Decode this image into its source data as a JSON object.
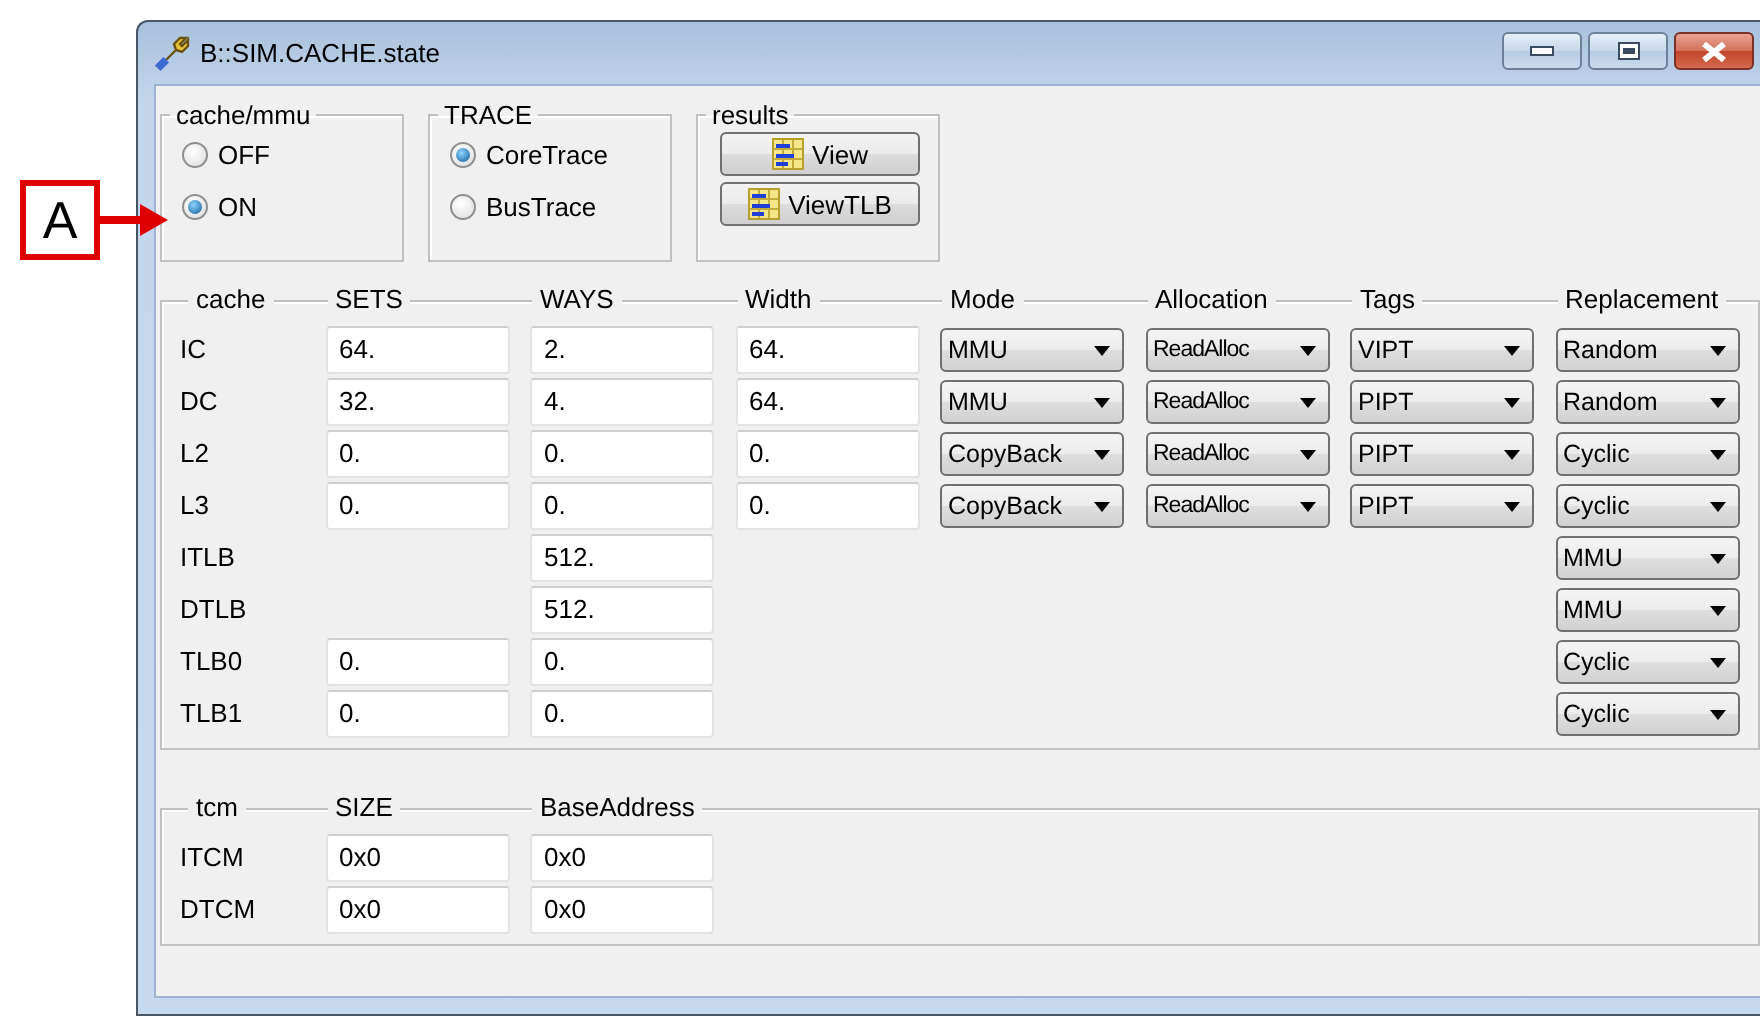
{
  "window": {
    "title": "B::SIM.CACHE.state"
  },
  "callout": {
    "label": "A"
  },
  "groups": [
    {
      "title": "cache/mmu",
      "kind": "radio",
      "options": [
        {
          "label": "OFF",
          "selected": false
        },
        {
          "label": "ON",
          "selected": true
        }
      ]
    },
    {
      "title": "TRACE",
      "kind": "radio",
      "options": [
        {
          "label": "CoreTrace",
          "selected": true
        },
        {
          "label": "BusTrace",
          "selected": false
        }
      ]
    },
    {
      "title": "results",
      "kind": "buttons",
      "buttons": [
        "View",
        "ViewTLB"
      ]
    }
  ],
  "cache": {
    "columns": [
      "cache",
      "SETS",
      "WAYS",
      "Width",
      "Mode",
      "Allocation",
      "Tags",
      "Replacement"
    ],
    "rows": [
      {
        "cells": [
          {
            "kind": "label",
            "value": "IC"
          },
          {
            "kind": "field",
            "value": "64."
          },
          {
            "kind": "field",
            "value": "2."
          },
          {
            "kind": "field",
            "value": "64."
          },
          {
            "kind": "dropdown",
            "value": "MMU"
          },
          {
            "kind": "dropdown",
            "value": "ReadAlloc"
          },
          {
            "kind": "dropdown",
            "value": "VIPT"
          },
          {
            "kind": "dropdown",
            "value": "Random"
          }
        ]
      },
      {
        "cells": [
          {
            "kind": "label",
            "value": "DC"
          },
          {
            "kind": "field",
            "value": "32."
          },
          {
            "kind": "field",
            "value": "4."
          },
          {
            "kind": "field",
            "value": "64."
          },
          {
            "kind": "dropdown",
            "value": "MMU"
          },
          {
            "kind": "dropdown",
            "value": "ReadAlloc"
          },
          {
            "kind": "dropdown",
            "value": "PIPT"
          },
          {
            "kind": "dropdown",
            "value": "Random"
          }
        ]
      },
      {
        "cells": [
          {
            "kind": "label",
            "value": "L2"
          },
          {
            "kind": "field",
            "value": "0."
          },
          {
            "kind": "field",
            "value": "0."
          },
          {
            "kind": "field",
            "value": "0."
          },
          {
            "kind": "dropdown",
            "value": "CopyBack"
          },
          {
            "kind": "dropdown",
            "value": "ReadAlloc"
          },
          {
            "kind": "dropdown",
            "value": "PIPT"
          },
          {
            "kind": "dropdown",
            "value": "Cyclic"
          }
        ]
      },
      {
        "cells": [
          {
            "kind": "label",
            "value": "L3"
          },
          {
            "kind": "field",
            "value": "0."
          },
          {
            "kind": "field",
            "value": "0."
          },
          {
            "kind": "field",
            "value": "0."
          },
          {
            "kind": "dropdown",
            "value": "CopyBack"
          },
          {
            "kind": "dropdown",
            "value": "ReadAlloc"
          },
          {
            "kind": "dropdown",
            "value": "PIPT"
          },
          {
            "kind": "dropdown",
            "value": "Cyclic"
          }
        ]
      },
      {
        "cells": [
          {
            "kind": "label",
            "value": "ITLB"
          },
          {
            "kind": "empty"
          },
          {
            "kind": "field",
            "value": "512."
          },
          {
            "kind": "empty"
          },
          {
            "kind": "empty"
          },
          {
            "kind": "empty"
          },
          {
            "kind": "empty"
          },
          {
            "kind": "dropdown",
            "value": "MMU"
          }
        ]
      },
      {
        "cells": [
          {
            "kind": "label",
            "value": "DTLB"
          },
          {
            "kind": "empty"
          },
          {
            "kind": "field",
            "value": "512."
          },
          {
            "kind": "empty"
          },
          {
            "kind": "empty"
          },
          {
            "kind": "empty"
          },
          {
            "kind": "empty"
          },
          {
            "kind": "dropdown",
            "value": "MMU"
          }
        ]
      },
      {
        "cells": [
          {
            "kind": "label",
            "value": "TLB0"
          },
          {
            "kind": "field",
            "value": "0."
          },
          {
            "kind": "field",
            "value": "0."
          },
          {
            "kind": "empty"
          },
          {
            "kind": "empty"
          },
          {
            "kind": "empty"
          },
          {
            "kind": "empty"
          },
          {
            "kind": "dropdown",
            "value": "Cyclic"
          }
        ]
      },
      {
        "cells": [
          {
            "kind": "label",
            "value": "TLB1"
          },
          {
            "kind": "field",
            "value": "0."
          },
          {
            "kind": "field",
            "value": "0."
          },
          {
            "kind": "empty"
          },
          {
            "kind": "empty"
          },
          {
            "kind": "empty"
          },
          {
            "kind": "empty"
          },
          {
            "kind": "dropdown",
            "value": "Cyclic"
          }
        ]
      }
    ]
  },
  "tcm": {
    "columns": [
      "tcm",
      "SIZE",
      "BaseAddress"
    ],
    "rows": [
      {
        "cells": [
          {
            "kind": "label",
            "value": "ITCM"
          },
          {
            "kind": "field",
            "value": "0x0"
          },
          {
            "kind": "field",
            "value": "0x0"
          }
        ]
      },
      {
        "cells": [
          {
            "kind": "label",
            "value": "DTCM"
          },
          {
            "kind": "field",
            "value": "0x0"
          },
          {
            "kind": "field",
            "value": "0x0"
          }
        ]
      }
    ]
  }
}
